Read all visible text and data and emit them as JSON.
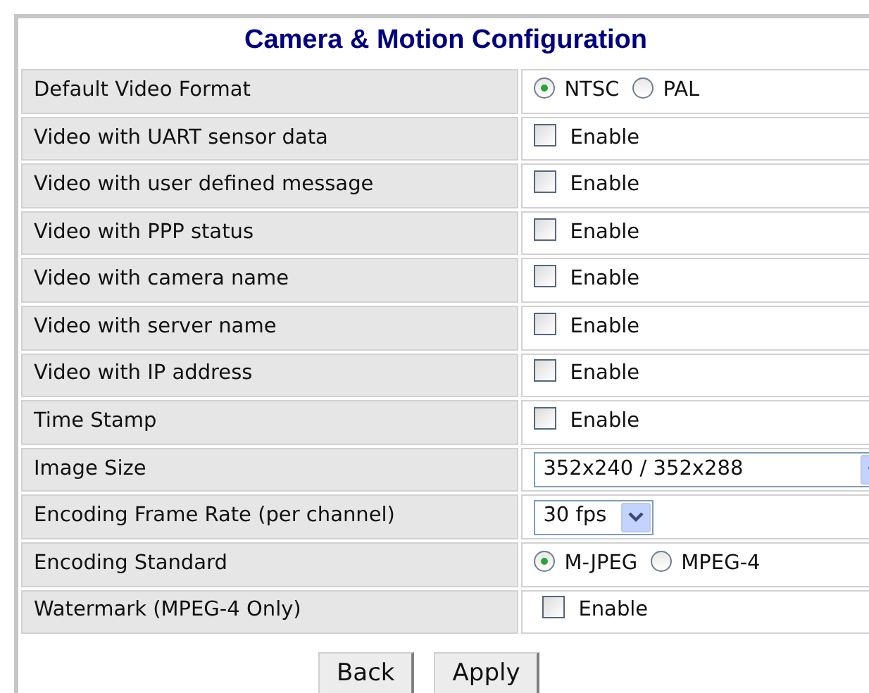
{
  "title": "Camera & Motion Configuration",
  "rows": [
    {
      "label": "Default Video Format",
      "kind": "radio",
      "options": [
        {
          "label": "NTSC",
          "selected": true
        },
        {
          "label": "PAL",
          "selected": false
        }
      ]
    },
    {
      "label": "Video with UART sensor data",
      "kind": "checkbox",
      "text": "Enable",
      "checked": false
    },
    {
      "label": "Video with user defined message",
      "kind": "checkbox",
      "text": "Enable",
      "checked": false
    },
    {
      "label": "Video with PPP status",
      "kind": "checkbox",
      "text": "Enable",
      "checked": false
    },
    {
      "label": "Video with camera name",
      "kind": "checkbox",
      "text": "Enable",
      "checked": false
    },
    {
      "label": "Video with server name",
      "kind": "checkbox",
      "text": "Enable",
      "checked": false
    },
    {
      "label": "Video with IP address",
      "kind": "checkbox",
      "text": "Enable",
      "checked": false
    },
    {
      "label": "Time Stamp",
      "kind": "checkbox",
      "text": "Enable",
      "checked": false
    },
    {
      "label": "Image Size",
      "kind": "select",
      "value": "352x240 / 352x288"
    },
    {
      "label": "Encoding Frame Rate (per channel)",
      "kind": "select",
      "value": "30 fps"
    },
    {
      "label": "Encoding Standard",
      "kind": "radio",
      "options": [
        {
          "label": "M-JPEG",
          "selected": true
        },
        {
          "label": "MPEG-4",
          "selected": false
        }
      ]
    },
    {
      "label": "Watermark (MPEG-4 Only)",
      "kind": "checkbox",
      "text": "Enable",
      "checked": false
    }
  ],
  "buttons": [
    "Back",
    "Apply"
  ]
}
